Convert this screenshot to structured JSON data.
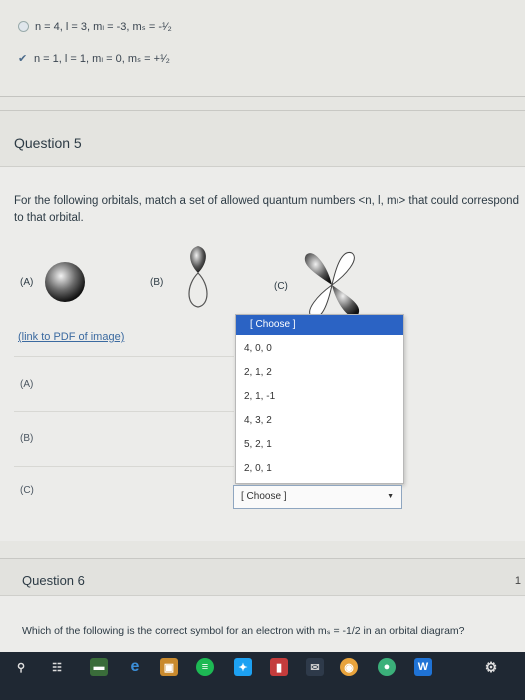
{
  "previous_answers": [
    {
      "text": "n = 4, l = 3, mₗ = -3, mₛ = -¹⁄₂",
      "selected": false
    },
    {
      "text": "n = 1, l = 1, mₗ = 0, mₛ = +¹⁄₂",
      "selected": true
    }
  ],
  "question5": {
    "title": "Question 5",
    "prompt": "For the following orbitals, match a set of allowed quantum numbers <n, l, mₗ> that could correspond to that orbital.",
    "orbital_labels": [
      "(A)",
      "(B)",
      "(C)"
    ],
    "pdf_link": "(link to PDF of image)",
    "rows": [
      "(A)",
      "(B)",
      "(C)"
    ],
    "dropdown": {
      "placeholder": "[ Choose ]",
      "options": [
        "4, 0, 0",
        "2, 1, 2",
        "2, 1, -1",
        "4, 3, 2",
        "5, 2, 1",
        "2, 0, 1"
      ],
      "selected": "[ Choose ]"
    }
  },
  "question6": {
    "title": "Question 6",
    "points": "1",
    "prompt": "Which of the following is the correct symbol for an electron with mₛ = -1/2 in an orbital diagram?"
  },
  "taskbar": {
    "icons": [
      "search-icon",
      "task-view-icon",
      "file-explorer-icon",
      "edge-icon",
      "store-icon",
      "spotify-icon",
      "twitter-icon",
      "app-red-icon",
      "mail-icon",
      "chrome-icon",
      "app-green-icon",
      "word-icon",
      "settings-icon"
    ],
    "colors": {
      "background": "#1f2833",
      "accent": "#2b63c4"
    }
  }
}
